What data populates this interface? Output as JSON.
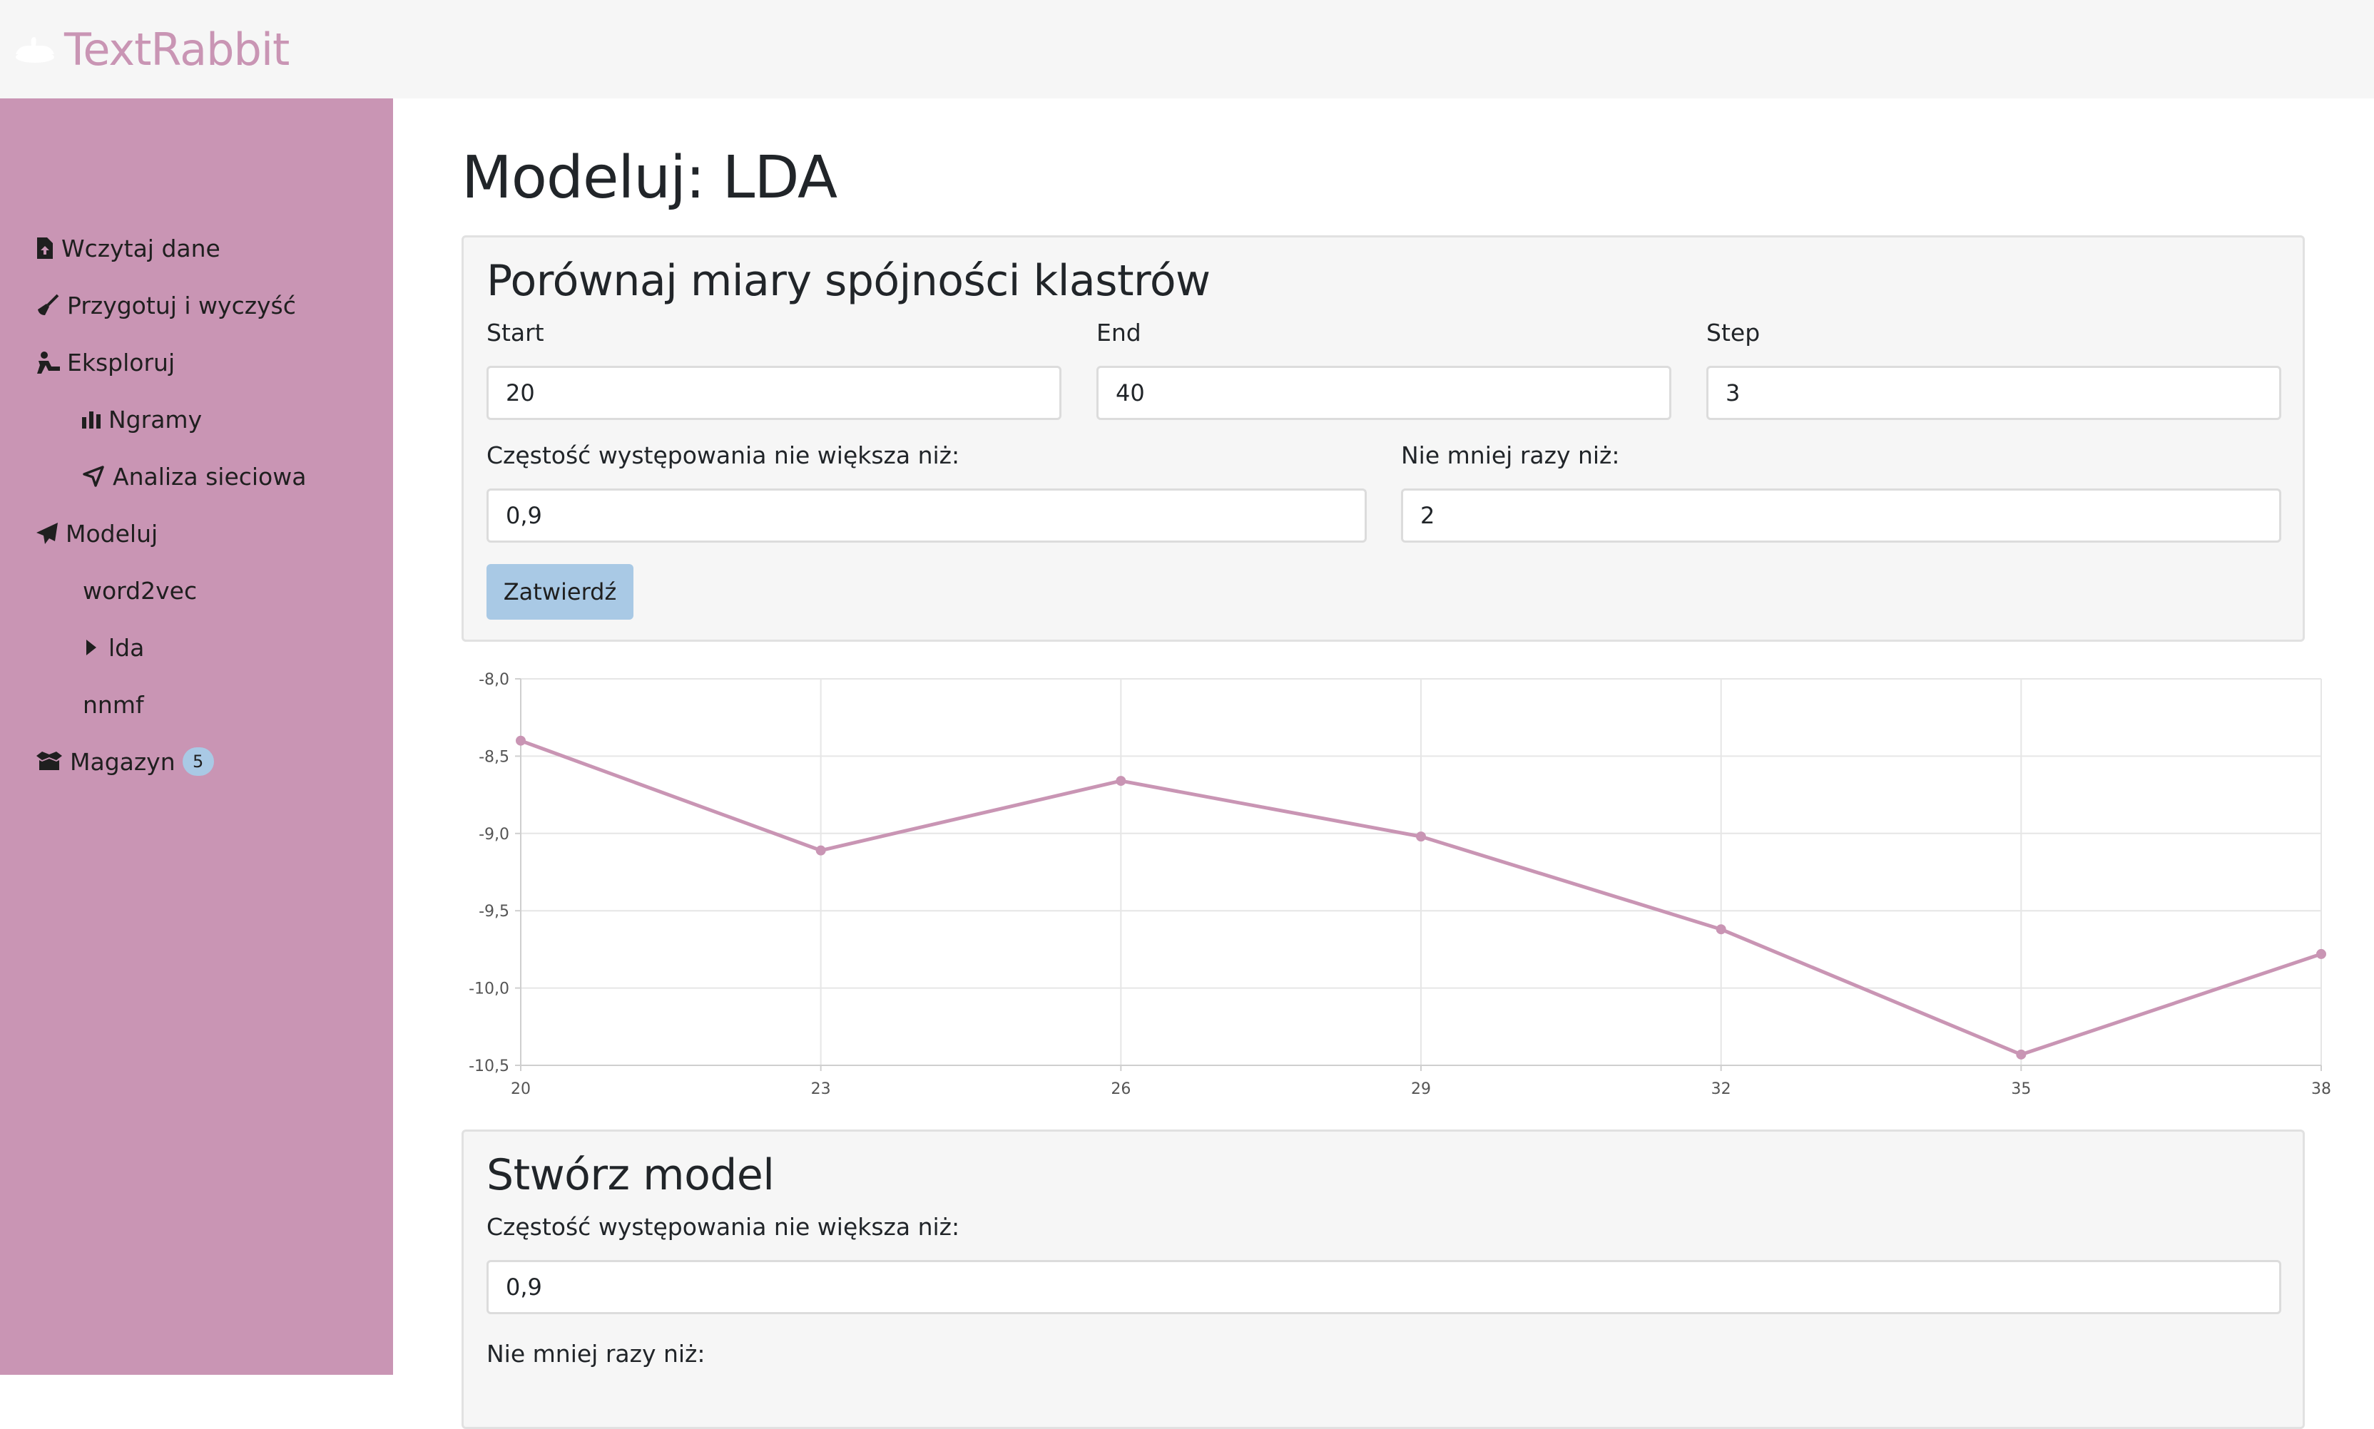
{
  "app": {
    "name": "TextRabbit"
  },
  "sidebar": {
    "items": [
      {
        "label": "Wczytaj dane",
        "icon": "file-upload-icon"
      },
      {
        "label": "Przygotuj i wyczyść",
        "icon": "broom-icon"
      },
      {
        "label": "Eksploruj",
        "icon": "explore-icon"
      },
      {
        "label": "Ngramy",
        "icon": "bar-chart-icon"
      },
      {
        "label": "Analiza sieciowa",
        "icon": "location-arrow-icon"
      },
      {
        "label": "Modeluj",
        "icon": "paper-plane-icon"
      },
      {
        "label": "word2vec"
      },
      {
        "label": "lda",
        "icon": "caret-right-icon"
      },
      {
        "label": "nnmf"
      },
      {
        "label": "Magazyn",
        "icon": "box-icon",
        "badge": "5"
      }
    ]
  },
  "page": {
    "title": "Modeluj: LDA"
  },
  "coherence": {
    "title": "Porównaj miary spójności klastrów",
    "start_label": "Start",
    "start_value": "20",
    "end_label": "End",
    "end_value": "40",
    "step_label": "Step",
    "step_value": "3",
    "maxdf_label": "Częstość występowania nie większa niż:",
    "maxdf_value": "0,9",
    "mindf_label": "Nie mniej razy niż:",
    "mindf_value": "2",
    "submit_label": "Zatwierdź"
  },
  "chart_data": {
    "type": "line",
    "x": [
      20,
      23,
      26,
      29,
      32,
      35,
      38
    ],
    "series": [
      {
        "values": [
          -8.4,
          -9.11,
          -8.66,
          -9.02,
          -9.62,
          -10.43,
          -9.78
        ]
      }
    ],
    "xticks": [
      "20",
      "23",
      "26",
      "29",
      "32",
      "35",
      "38"
    ],
    "yticks": [
      "-8,0",
      "-8,5",
      "-9,0",
      "-9,5",
      "-10,0",
      "-10,5"
    ],
    "ylim": [
      -10.5,
      -8.0
    ],
    "xlim": [
      20,
      38
    ],
    "grid": true,
    "color": "#c995b4"
  },
  "create_model": {
    "title": "Stwórz model",
    "maxdf_label": "Częstość występowania nie większa niż:",
    "maxdf_value": "0,9",
    "mindf_label": "Nie mniej razy niż:"
  },
  "colors": {
    "accent": "#c995b4",
    "button": "#a9c9e5",
    "topbar": "#f6f6f6"
  }
}
